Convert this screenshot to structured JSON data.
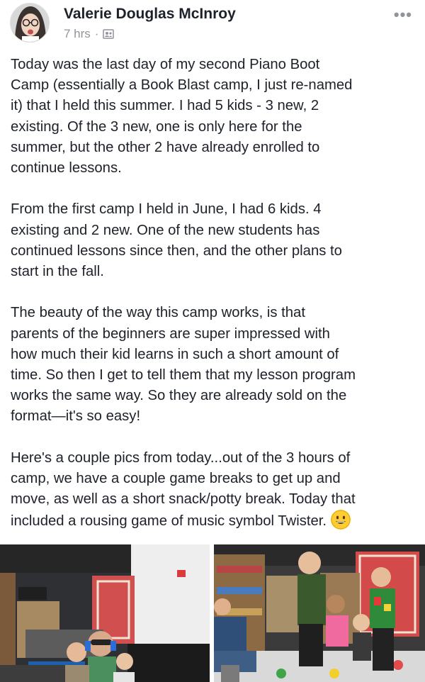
{
  "post": {
    "author": "Valerie Douglas McInroy",
    "time": "7 hrs",
    "separator": "·",
    "paragraphs": [
      "Today was the last day of my second Piano Boot\nCamp (essentially a Book Blast camp, I just re-named\nit) that I held this summer. I had 5 kids - 3 new, 2\nexisting. Of the 3 new, one is only here for the\nsummer, but the other 2 have already enrolled to\ncontinue lessons.",
      "From the first camp I held in June, I had 6 kids. 4\nexisting and 2 new. One of the new students has\ncontinued lessons since then, and the other plans to\nstart in the fall.",
      "The beauty of the way this camp works, is that\nparents of the beginners are super impressed with\nhow much their kid learns in such a short amount of\ntime. So then I get to tell them that my lesson program\nworks the same way. So they are already sold on the\nformat—it's so easy!",
      "Here's a couple pics from today...out of the 3 hours of\ncamp, we have a couple game breaks to get up and\nmove, as well as a short snack/potty break. Today that\nincluded a rousing game of music symbol Twister."
    ]
  },
  "icons": {
    "more": "more-options-icon",
    "audience": "friends-audience-icon",
    "emoji": "grinning-face-emoji-icon"
  },
  "colors": {
    "text": "#1d2129",
    "meta": "#90949c",
    "emoji": "#ffcc33"
  }
}
